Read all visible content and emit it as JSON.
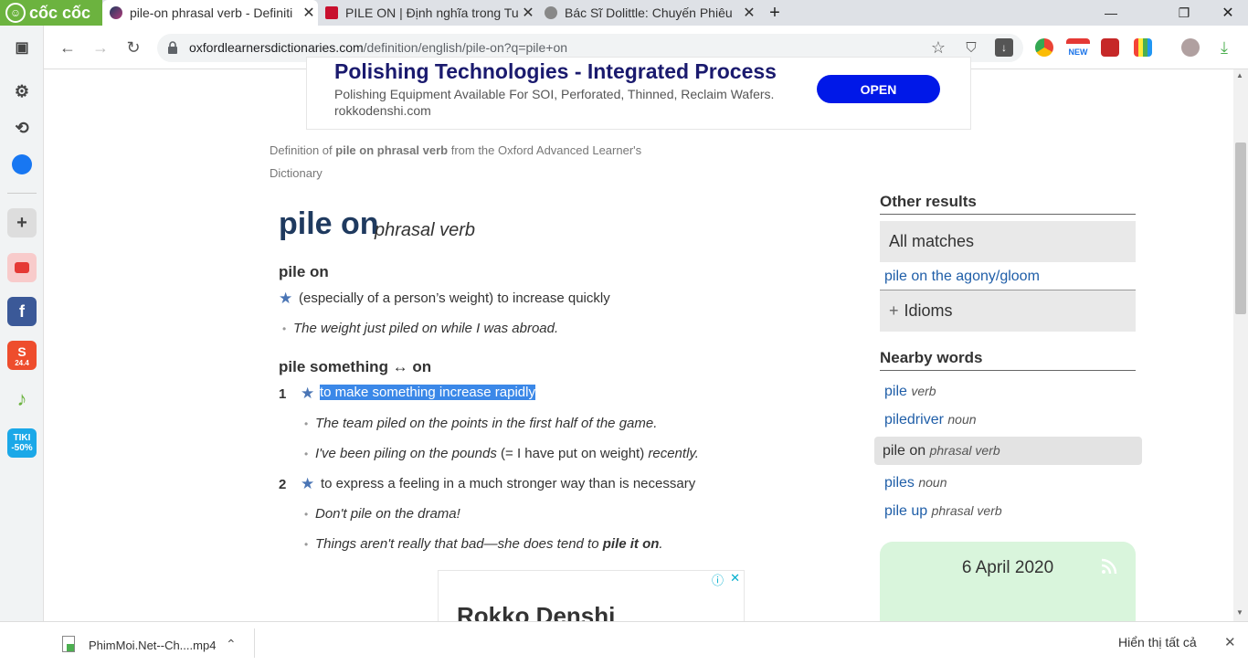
{
  "browser": {
    "logo_label": "cốc cốc",
    "tabs": [
      {
        "title": "pile-on phrasal verb - Definiti",
        "active": true
      },
      {
        "title": "PILE ON | Định nghĩa trong Tu",
        "active": false
      },
      {
        "title": "Bác Sĩ Dolittle: Chuyến Phiêu",
        "active": false
      }
    ],
    "new_tab": "+",
    "url_host": "oxfordlearnersdictionaries.com",
    "url_path": "/definition/english/pile-on?q=pile+on",
    "ext_new_badge": "NEW"
  },
  "sidebar": {
    "items": [
      "sidebar-toggle",
      "settings",
      "history",
      "messenger",
      "add",
      "youtube",
      "facebook",
      "shopee",
      "music",
      "tiki"
    ],
    "shopee_badge": "24.4",
    "tiki_label": "TIKI",
    "tiki_discount": "-50%"
  },
  "ad_top": {
    "headline": "Polishing Technologies - Integrated Process",
    "description": "Polishing Equipment Available For SOI, Perforated, Thinned, Reclaim Wafers.",
    "domain": "rokkodenshi.com",
    "button": "OPEN"
  },
  "source": {
    "prefix": "Definition of ",
    "term": "pile on phrasal verb",
    "suffix": " from the Oxford Advanced Learner's",
    "line2": "Dictionary"
  },
  "entry": {
    "headword": "pile on",
    "pos": "phrasal verb",
    "sense_group_1": {
      "heading": "pile on",
      "definition": "(especially of a person’s weight) to increase quickly",
      "example": "The weight just piled on while I was abroad."
    },
    "sense_group_2": {
      "heading": "pile something ↔ on",
      "senses": [
        {
          "num": "1",
          "definition": "to make something increase rapidly",
          "examples": [
            "The team piled on the points in the first half of the game.",
            "I've been piling on the pounds"
          ],
          "example2_gloss": " (= I have put on weight) ",
          "example2_end": "recently."
        },
        {
          "num": "2",
          "definition": "to express a feeling in a much stronger way than is necessary",
          "examples": [
            "Don't pile on the drama!",
            "Things aren't really that bad—she does tend to "
          ],
          "example2_bold": "pile it on",
          "example2_end": "."
        }
      ]
    }
  },
  "right": {
    "other_results": "Other results",
    "all_matches": "All matches",
    "match_link": "pile on the agony/gloom",
    "idioms": "Idioms",
    "idioms_icon": "+",
    "nearby_words": "Nearby words",
    "nearby": [
      {
        "word": "pile",
        "pos": "verb"
      },
      {
        "word": "piledriver",
        "pos": "noun"
      },
      {
        "word": "pile on",
        "pos": "phrasal verb"
      },
      {
        "word": "piles",
        "pos": "noun"
      },
      {
        "word": "pile up",
        "pos": "phrasal verb"
      }
    ],
    "wotd_date": "6 April 2020"
  },
  "ad_bottom": {
    "title": "Rokko Denshi"
  },
  "download_bar": {
    "file": "PhimMoi.Net--Ch....mp4",
    "show_all": "Hiển thị tất cả"
  }
}
